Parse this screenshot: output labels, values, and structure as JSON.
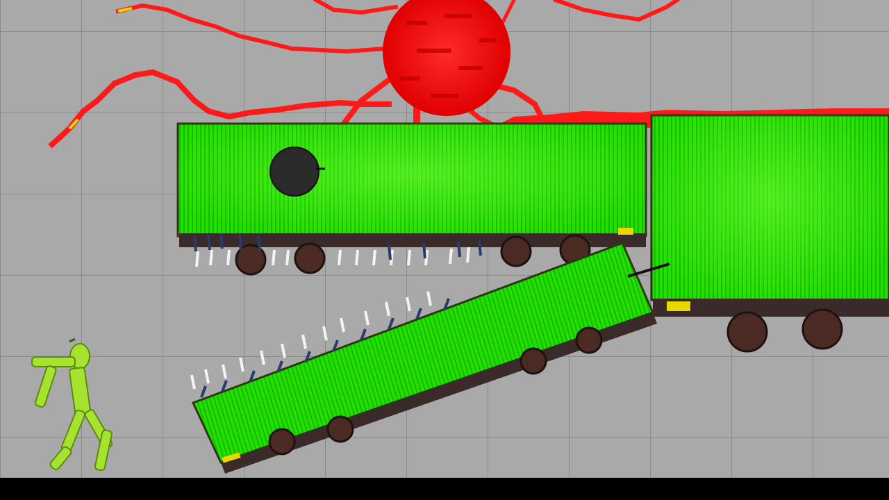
{
  "scene": {
    "colors": {
      "background": "#a9a9a9",
      "grid_line": "#8e8e8e",
      "container_green": "#22e000",
      "container_dark_green": "#0f7a00",
      "creature_red": "#ff1a1a",
      "creature_dark_red": "#c40000",
      "melon_green": "#a6e22e",
      "wheel": "#4a2a22",
      "chassis": "#3b2a2a",
      "spike_white": "#f4f4f4",
      "spike_blue": "#2a3a6a",
      "letterbox": "#000000"
    },
    "entities": [
      {
        "id": "red-sun-creature",
        "icon": "sun-creature-icon"
      },
      {
        "id": "green-container-top",
        "icon": "shipping-container-icon"
      },
      {
        "id": "green-container-jaw",
        "icon": "shipping-container-icon"
      },
      {
        "id": "green-container-rear",
        "icon": "shipping-container-icon"
      },
      {
        "id": "melon-ragdoll",
        "icon": "melon-person-icon"
      },
      {
        "id": "black-bomb",
        "icon": "bomb-icon"
      }
    ]
  }
}
